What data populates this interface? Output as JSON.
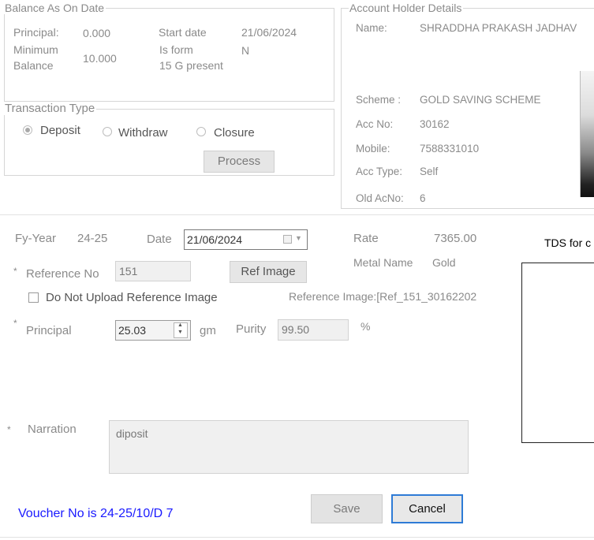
{
  "balance": {
    "legend": "Balance As On Date",
    "principal_label": "Principal:",
    "principal_value": "0.000",
    "min_balance_label_1": "Minimum",
    "min_balance_label_2": "Balance",
    "min_balance_value": "10.000",
    "start_date_label": "Start date",
    "start_date_value": "21/06/2024",
    "is_form_label_1": "Is form",
    "is_form_label_2": "15 G present",
    "is_form_value": "N"
  },
  "transaction": {
    "legend": "Transaction Type",
    "options": [
      "Deposit",
      "Withdraw",
      "Closure"
    ],
    "selected": "Deposit",
    "process_label": "Process"
  },
  "account": {
    "legend": "Account Holder Details",
    "name_label": "Name:",
    "name_value": "SHRADDHA PRAKASH JADHAV",
    "scheme_label": "Scheme :",
    "scheme_value": "GOLD SAVING SCHEME",
    "accno_label": "Acc No:",
    "accno_value": "30162",
    "mobile_label": "Mobile:",
    "mobile_value": "7588331010",
    "acctype_label": "Acc Type:",
    "acctype_value": "Self",
    "oldacno_label": "Old AcNo:",
    "oldacno_value": "6"
  },
  "form": {
    "fy_label": "Fy-Year",
    "fy_value": "24-25",
    "date_label": "Date",
    "date_value": "21/06/2024",
    "rate_label": "Rate",
    "rate_value": "7365.00",
    "metal_label": "Metal Name",
    "metal_value": "Gold",
    "tds_label": "TDS for c",
    "ref_no_label": "Reference No",
    "ref_no_value": "151",
    "ref_image_button": "Ref Image",
    "do_not_upload_label": "Do Not Upload Reference Image",
    "reference_image_text": "Reference Image:[Ref_151_30162202",
    "principal_label": "Principal",
    "principal_value": "25.03",
    "unit_gm": "gm",
    "purity_label": "Purity",
    "purity_value": "99.50",
    "percent": "%",
    "narration_label": "Narration",
    "narration_value": "diposit",
    "required_mark": "*"
  },
  "footer": {
    "voucher_text": "Voucher No is 24-25/10/D 7",
    "save_label": "Save",
    "cancel_label": "Cancel"
  },
  "colors": {
    "voucher": "#1a1aff",
    "cancel_border": "#2e7bd6"
  }
}
